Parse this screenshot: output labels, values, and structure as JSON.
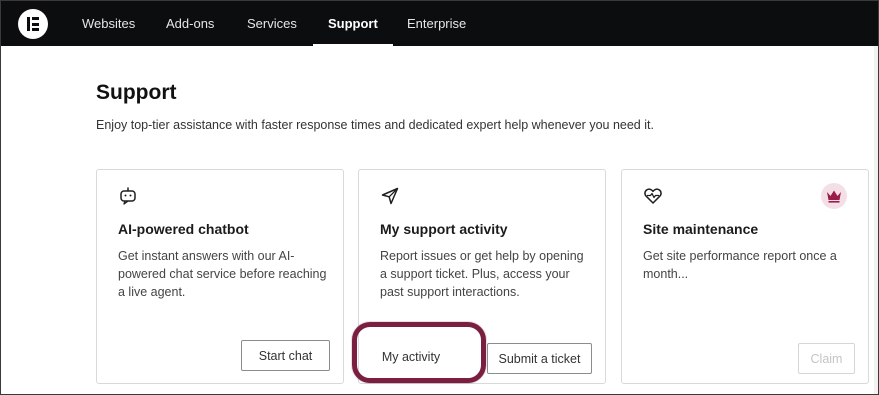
{
  "nav": {
    "items": [
      {
        "label": "Websites",
        "active": false
      },
      {
        "label": "Add-ons",
        "active": false
      },
      {
        "label": "Services",
        "active": false
      },
      {
        "label": "Support",
        "active": true
      },
      {
        "label": "Enterprise",
        "active": false
      }
    ],
    "logo_icon": "elementor-logo-icon"
  },
  "header": {
    "title": "Support",
    "subtitle": "Enjoy top-tier assistance with faster response times and dedicated expert help whenever you need it."
  },
  "cards": [
    {
      "icon": "chatbot-icon",
      "title": "AI-powered chatbot",
      "description": "Get instant answers with our AI-powered chat service before reaching a live agent.",
      "buttons": [
        {
          "label": "Start chat",
          "enabled": true
        }
      ]
    },
    {
      "icon": "paper-plane-icon",
      "title": "My support activity",
      "description": "Report issues or get help by opening a support ticket. Plus, access your past support interactions.",
      "buttons": [
        {
          "label": "My activity",
          "enabled": true,
          "highlighted": true
        },
        {
          "label": "Submit a ticket",
          "enabled": true
        }
      ]
    },
    {
      "icon": "heart-pulse-icon",
      "title": "Site maintenance",
      "description": "Get site performance report once a month...",
      "premium_badge_icon": "crown-icon",
      "buttons": [
        {
          "label": "Claim",
          "enabled": false
        }
      ]
    }
  ],
  "colors": {
    "nav_bg": "#0c0d0e",
    "highlight_ring": "#7a1f40",
    "crown": "#9b1c4a",
    "crown_badge_bg": "#f5dfe6"
  }
}
